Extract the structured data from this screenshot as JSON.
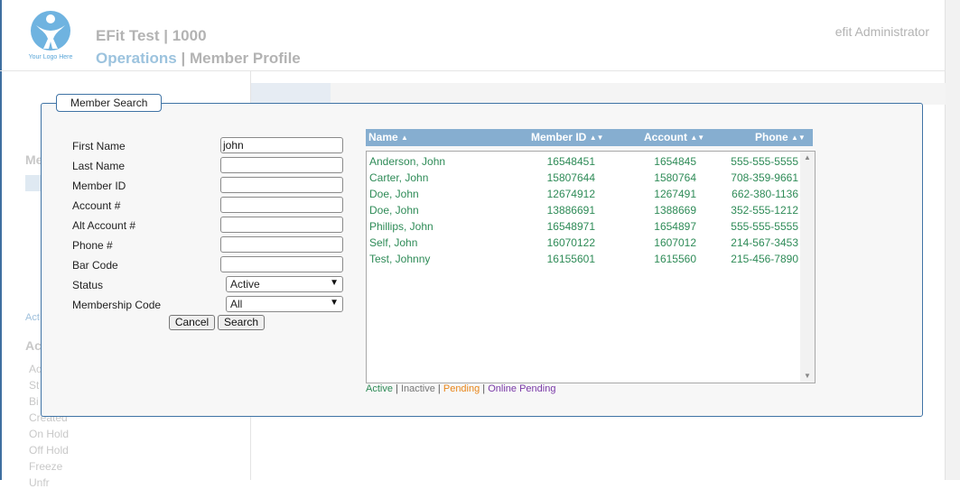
{
  "header": {
    "logo_text": "Your Logo Here",
    "app_title": "EFit Test | 1000",
    "section": "Operations",
    "page_title": "Member Profile",
    "separator": " | ",
    "user": "efit Administrator"
  },
  "background": {
    "sidebar_heading1": "Me",
    "sidebar_heading2": "Ac",
    "sidebar_link": "Act",
    "sidebar_items": [
      "Ac",
      "St",
      "Bi",
      "Created",
      "On Hold",
      "Off Hold",
      "Freeze",
      "Unfr"
    ]
  },
  "dialog": {
    "title": "Member Search",
    "fields": {
      "first_name": {
        "label": "First Name",
        "value": "john"
      },
      "last_name": {
        "label": "Last Name",
        "value": ""
      },
      "member_id": {
        "label": "Member ID",
        "value": ""
      },
      "account": {
        "label": "Account #",
        "value": ""
      },
      "alt_account": {
        "label": "Alt Account #",
        "value": ""
      },
      "phone": {
        "label": "Phone #",
        "value": ""
      },
      "bar_code": {
        "label": "Bar Code",
        "value": ""
      },
      "status": {
        "label": "Status",
        "value": "Active"
      },
      "membership_code": {
        "label": "Membership Code",
        "value": "All"
      }
    },
    "buttons": {
      "cancel": "Cancel",
      "search": "Search"
    }
  },
  "results": {
    "columns": {
      "name": "Name",
      "member_id": "Member ID",
      "account": "Account",
      "phone": "Phone"
    },
    "rows": [
      {
        "name": "Anderson, John",
        "member_id": "16548451",
        "account": "1654845",
        "phone": "555-555-5555"
      },
      {
        "name": "Carter, John",
        "member_id": "15807644",
        "account": "1580764",
        "phone": "708-359-9661"
      },
      {
        "name": "Doe, John",
        "member_id": "12674912",
        "account": "1267491",
        "phone": "662-380-1136"
      },
      {
        "name": "Doe, John",
        "member_id": "13886691",
        "account": "1388669",
        "phone": "352-555-1212"
      },
      {
        "name": "Phillips, John",
        "member_id": "16548971",
        "account": "1654897",
        "phone": "555-555-5555"
      },
      {
        "name": "Self, John",
        "member_id": "16070122",
        "account": "1607012",
        "phone": "214-567-3453"
      },
      {
        "name": "Test, Johnny",
        "member_id": "16155601",
        "account": "1615560",
        "phone": "215-456-7890"
      }
    ],
    "legend": {
      "active": "Active",
      "inactive": "Inactive",
      "pending": "Pending",
      "online_pending": "Online Pending",
      "separator": " | "
    }
  },
  "colors": {
    "active": "#2e8b57",
    "inactive": "#777777",
    "pending": "#e8861a",
    "online_pending": "#7a3aa8",
    "header_bar": "#86aed0",
    "border": "#3f73a5"
  }
}
